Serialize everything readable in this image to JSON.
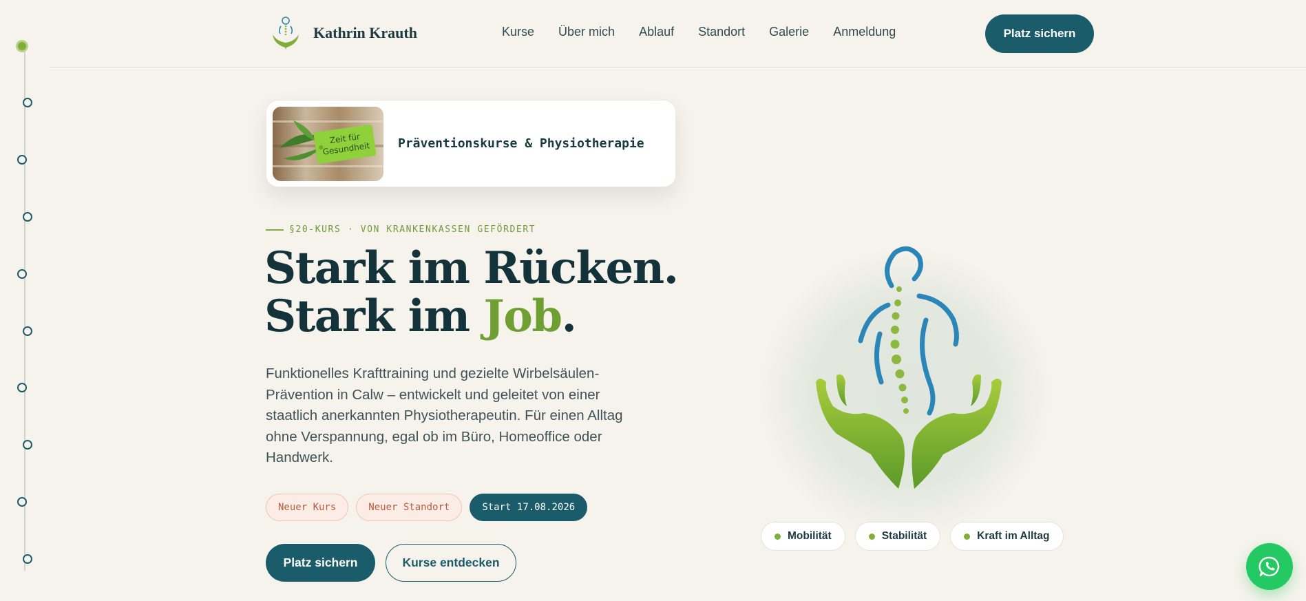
{
  "brand": {
    "name": "Kathrin Krauth",
    "logo_icon": "hands-spine-logo-icon"
  },
  "nav": {
    "items": [
      {
        "label": "Kurse"
      },
      {
        "label": "Über mich"
      },
      {
        "label": "Ablauf"
      },
      {
        "label": "Standort"
      },
      {
        "label": "Galerie"
      },
      {
        "label": "Anmeldung"
      }
    ],
    "cta_label": "Platz sichern"
  },
  "info_card": {
    "image_caption": "Zeit für Gesundheit",
    "title": "Präventionskurse & Physiotherapie"
  },
  "hero": {
    "eyebrow": "§20-KURS · VON KRANKENKASSEN GEFÖRDERT",
    "headline_line1": "Stark im Rücken.",
    "headline_line2_prefix": "Stark im ",
    "headline_line2_highlight": "Job",
    "headline_line2_suffix": ".",
    "lead": "Funktionelles Krafttraining und gezielte Wirbelsäulen-Prävention in Calw – entwickelt und geleitet von einer staatlich anerkannten Physiotherapeutin. Für einen Alltag ohne Verspannung, egal ob im Büro, Homeoffice oder Handwerk.",
    "tags": [
      {
        "label": "Neuer Kurs"
      },
      {
        "label": "Neuer Standort"
      },
      {
        "label": "Start 17.08.2026"
      }
    ],
    "primary_button": "Platz sichern",
    "secondary_button": "Kurse entdecken",
    "illustration_icon": "hands-spine-illustration-icon",
    "pills": [
      {
        "label": "Mobilität"
      },
      {
        "label": "Stabilität"
      },
      {
        "label": "Kraft im Alltag"
      }
    ]
  },
  "timeline": {
    "total_steps": 10,
    "active_step": 1
  },
  "floating": {
    "whatsapp_icon": "whatsapp-icon"
  },
  "colors": {
    "background": "#f6f3ec",
    "primary": "#1a5c69",
    "accent_green": "#7fae3b",
    "headline": "#14323a",
    "tag_soft_text": "#b95c3c",
    "whatsapp": "#25c964"
  }
}
